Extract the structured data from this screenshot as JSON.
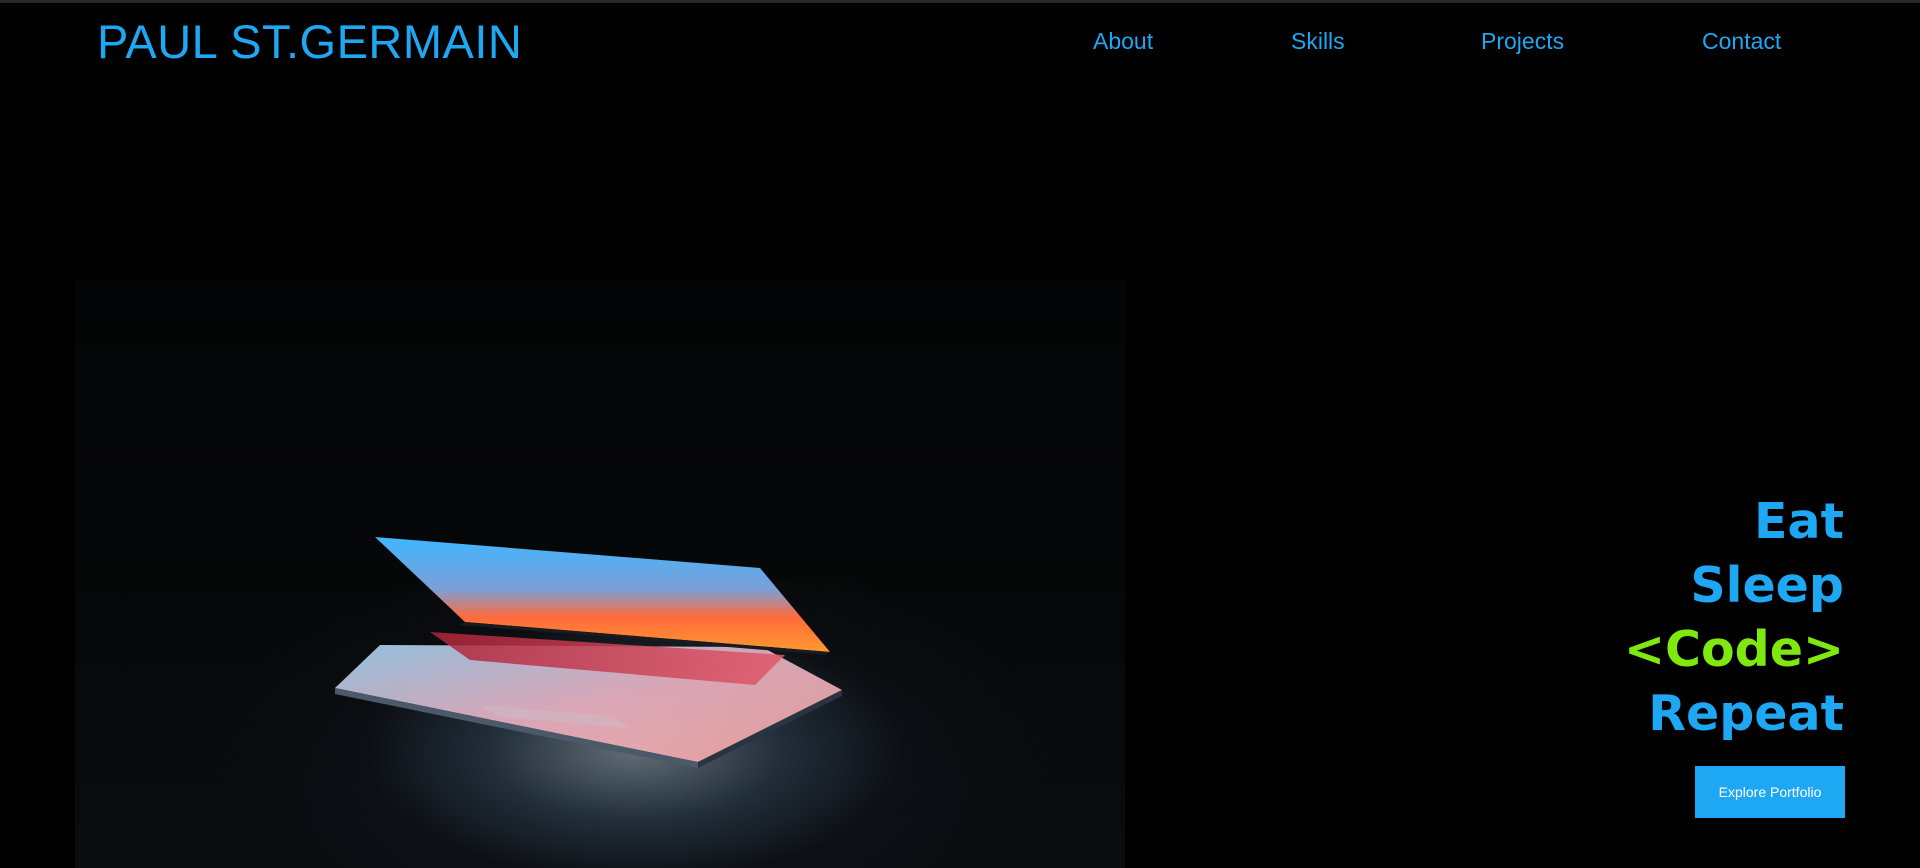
{
  "header": {
    "logo_text": "PAUL ST.GERMAIN",
    "nav": [
      {
        "label": "About"
      },
      {
        "label": "Skills"
      },
      {
        "label": "Projects"
      },
      {
        "label": "Contact"
      }
    ]
  },
  "hero": {
    "slogan_lines": [
      "Eat",
      "Sleep",
      "<Code>",
      "Repeat"
    ],
    "cta_label": "Explore Portfolio"
  },
  "colors": {
    "accent_blue": "#1ea7f2",
    "accent_green": "#7ee80f",
    "background": "#000000"
  }
}
